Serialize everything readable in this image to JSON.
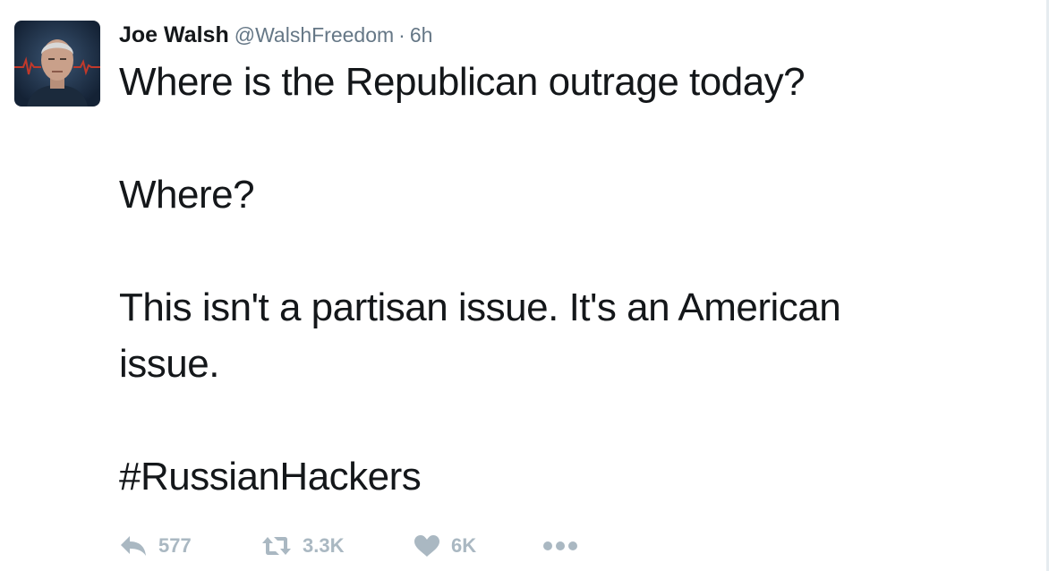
{
  "tweet": {
    "author_name": "Joe Walsh",
    "handle": "@WalshFreedom",
    "separator": "·",
    "timestamp": "6h",
    "lines": [
      "Where is the Republican outrage today?",
      "Where?",
      "This isn't a partisan issue. It's an American",
      "issue.",
      "#RussianHackers"
    ]
  },
  "actions": {
    "reply_count": "577",
    "retweet_count": "3.3K",
    "like_count": "6K"
  },
  "icons": {
    "reply": "reply-arrow-icon",
    "retweet": "retweet-icon",
    "like": "heart-icon",
    "more": "more-dots-icon"
  },
  "colors": {
    "text": "#14171a",
    "secondary": "#657786",
    "action": "#aab8c2"
  }
}
